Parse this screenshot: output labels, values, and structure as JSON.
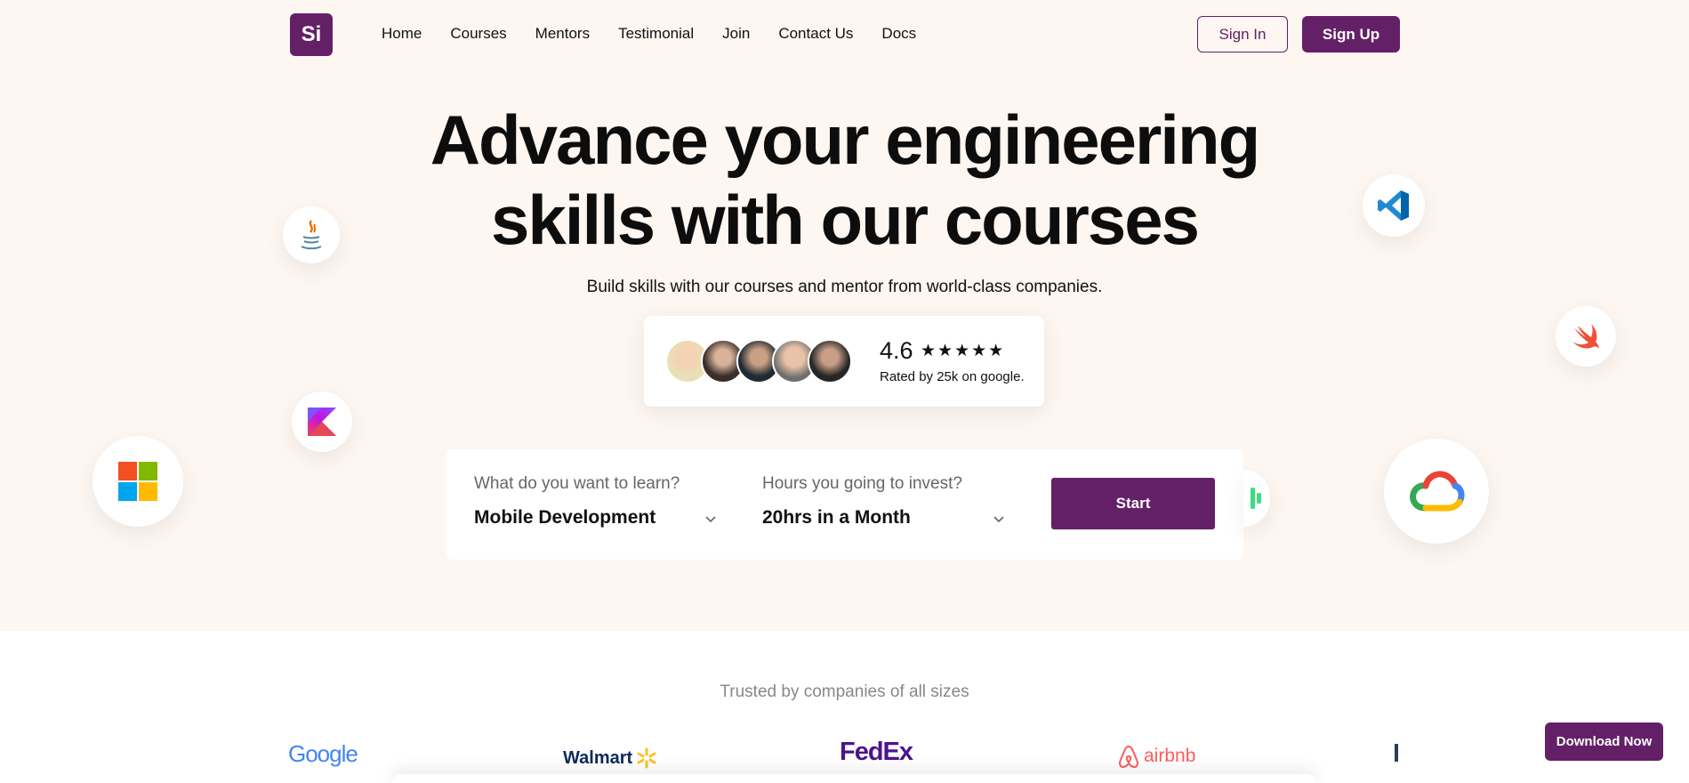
{
  "brand": {
    "logo_text": "Si",
    "accent": "#632067",
    "hero_bg": "#fdf6f1"
  },
  "nav": {
    "items": [
      "Home",
      "Courses",
      "Mentors",
      "Testimonial",
      "Join",
      "Contact Us",
      "Docs"
    ],
    "sign_in": "Sign In",
    "sign_up": "Sign Up"
  },
  "hero": {
    "headline_line1": "Advance your engineering",
    "headline_line2": "skills with our courses",
    "subheadline": "Build skills with our courses and mentor from world-class companies."
  },
  "rating": {
    "value": "4.6",
    "stars": "★★★★★",
    "caption": "Rated by 25k on google.",
    "avatar_count": 5
  },
  "search": {
    "learn_label": "What do you want to learn?",
    "learn_value": "Mobile Development",
    "hours_label": "Hours you going to invest?",
    "hours_value": "20hrs in a Month",
    "start_button": "Start"
  },
  "floating_icons": [
    "java-icon",
    "kotlin-icon",
    "microsoft-icon",
    "vscode-icon",
    "swift-icon",
    "google-cloud-icon",
    "android-icon"
  ],
  "trusted": {
    "title": "Trusted by companies of all sizes",
    "companies": [
      "Google",
      "Walmart",
      "FedEx",
      "airbnb"
    ]
  },
  "download_button": "Download Now"
}
